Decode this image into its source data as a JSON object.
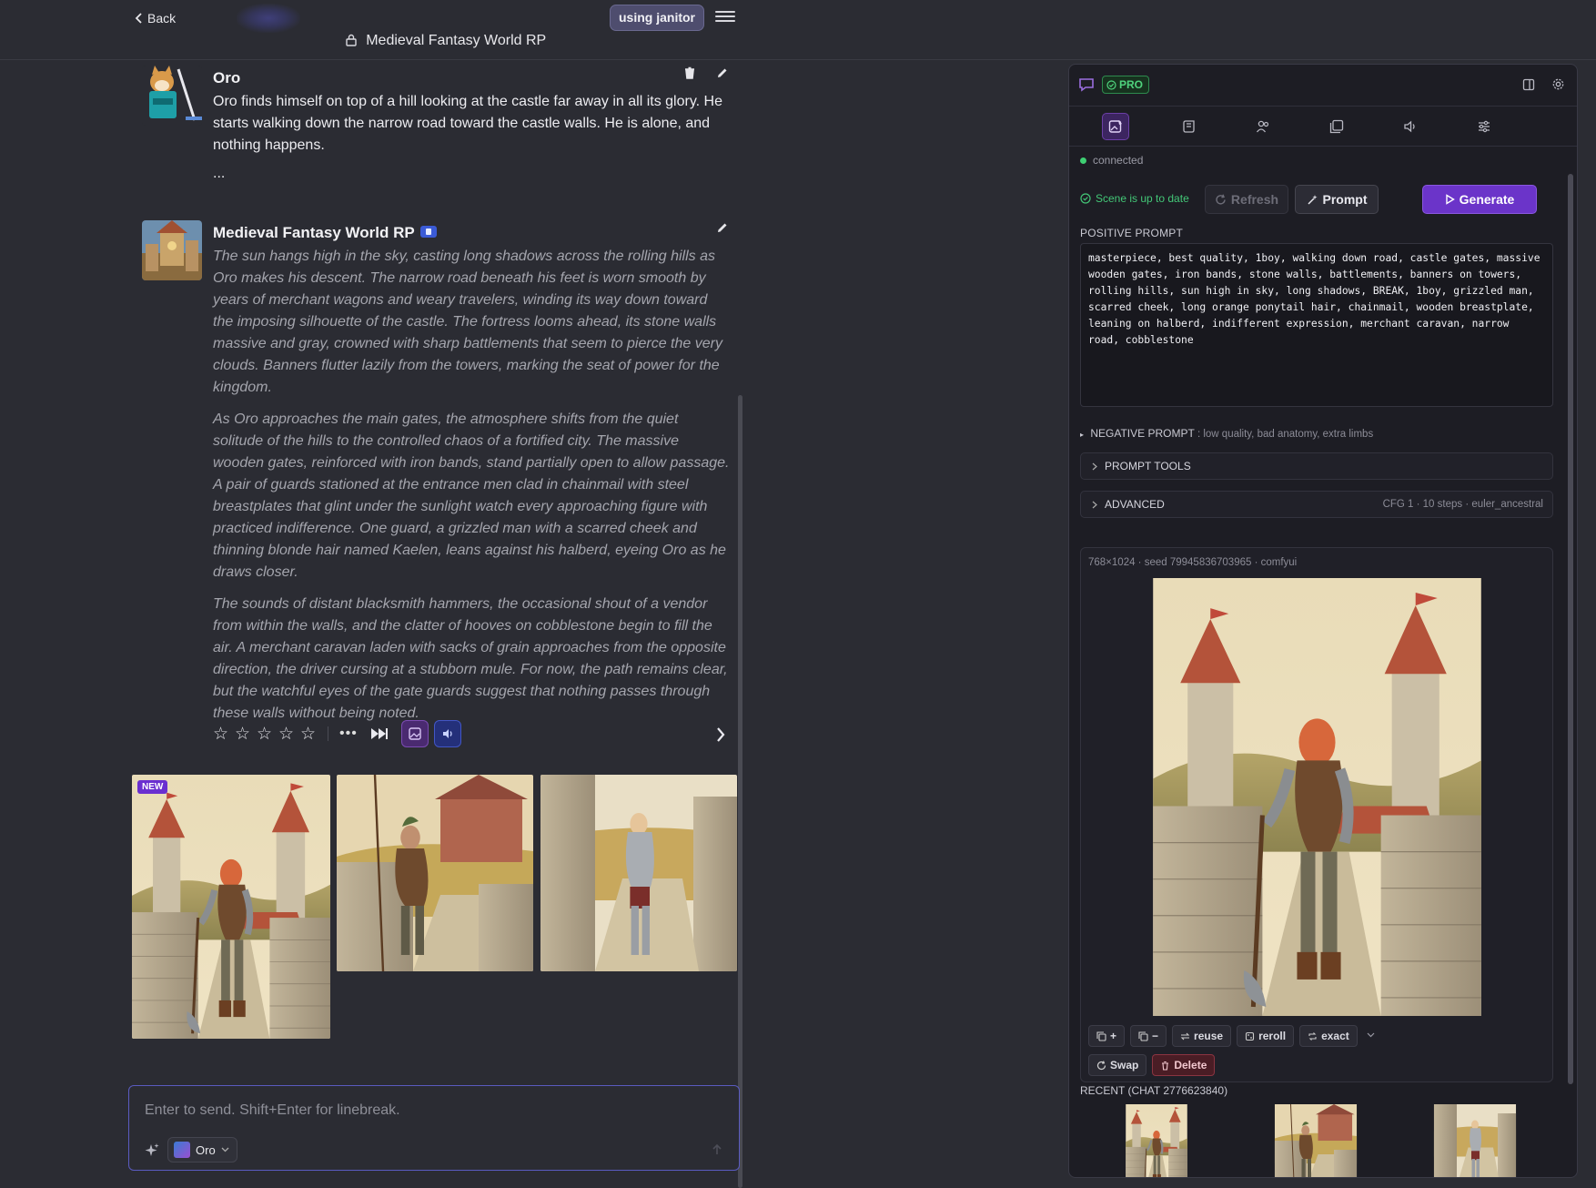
{
  "header": {
    "back_label": "Back",
    "janitor_label": "using janitor",
    "chat_title": "Medieval Fantasy World RP"
  },
  "messages": [
    {
      "name": "Oro",
      "paragraphs": [
        "Oro finds himself on top of a hill looking at the castle far away in all its glory. He starts walking down the narrow road toward the castle walls. He is alone, and nothing happens.",
        "..."
      ]
    },
    {
      "name": "Medieval Fantasy World RP",
      "paragraphs": [
        "The sun hangs high in the sky, casting long shadows across the rolling hills as Oro makes his descent. The narrow road beneath his feet is worn smooth by years of merchant wagons and weary travelers, winding its way down toward the imposing silhouette of the castle. The fortress looms ahead, its stone walls massive and gray, crowned with sharp battlements that seem to pierce the very clouds. Banners flutter lazily from the towers, marking the seat of power for the kingdom.",
        "As Oro approaches the main gates, the atmosphere shifts from the quiet solitude of the hills to the controlled chaos of a fortified city. The massive wooden gates, reinforced with iron bands, stand partially open to allow passage. A pair of guards stationed at the entrance men clad in chainmail with steel breastplates that glint under the sunlight watch every approaching figure with practiced indifference. One guard, a grizzled man with a scarred cheek and thinning blonde hair named Kaelen, leans against his halberd, eyeing Oro as he draws closer.",
        "The sounds of distant blacksmith hammers, the occasional shout of a vendor from within the walls, and the clatter of hooves on cobblestone begin to fill the air. A merchant caravan laden with sacks of grain approaches from the opposite direction, the driver cursing at a stubborn mule. For now, the path remains clear, but the watchful eyes of the gate guards suggest that nothing passes through these walls without being noted."
      ]
    }
  ],
  "rating": {
    "stars": 0,
    "max": 5
  },
  "thumbnails": {
    "new_label": "NEW"
  },
  "composer": {
    "placeholder": "Enter to send. Shift+Enter for linebreak.",
    "persona": "Oro"
  },
  "panel": {
    "pro_label": "PRO",
    "status": "connected",
    "scene_status": "Scene is up to date",
    "refresh_label": "Refresh",
    "prompt_label": "Prompt",
    "generate_label": "Generate",
    "positive_label": "POSITIVE PROMPT",
    "positive_prompt": "masterpiece, best quality, 1boy, walking down road, castle gates, massive wooden gates, iron bands, stone walls, battlements, banners on towers, rolling hills, sun high in sky, long shadows, BREAK, 1boy, grizzled man, scarred cheek, long orange ponytail hair, chainmail, wooden breastplate, leaning on halberd, indifferent expression, merchant caravan, narrow road, cobblestone",
    "negative_label": "NEGATIVE PROMPT",
    "negative_value": ": low quality, bad anatomy, extra limbs",
    "prompt_tools_label": "PROMPT TOOLS",
    "advanced_label": "ADVANCED",
    "advanced_meta": "CFG 1 · 10 steps · euler_ancestral",
    "gen_meta": "768×1024 · seed 79945836703965 · comfyui",
    "tools": {
      "copy_plus": "+",
      "copy_minus": "−",
      "reuse": "reuse",
      "reroll": "reroll",
      "exact": "exact",
      "swap": "Swap",
      "delete": "Delete"
    },
    "recent_label": "RECENT (CHAT 2776623840)"
  },
  "colors": {
    "accent": "#6b34c9",
    "success": "#3ecf73",
    "danger": "#8a3441",
    "composer_border": "#5a5bc0"
  }
}
